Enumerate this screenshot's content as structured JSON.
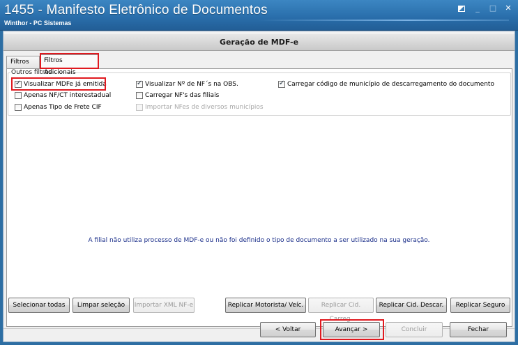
{
  "window": {
    "title": "1455 - Manifesto Eletrônico de Documentos",
    "subtitle": "Winthor - PC Sistemas",
    "controls": {
      "minimize": "_",
      "maximize": "□",
      "close": "✕"
    }
  },
  "header": {
    "title": "Geração de MDF-e"
  },
  "tabs": [
    {
      "label": "Filtros",
      "active": false
    },
    {
      "label": "Filtros Adicionais",
      "active": true
    }
  ],
  "group": {
    "label": "Outros filtros",
    "options": [
      {
        "label": "Visualizar MDFe já emitida",
        "checked": true,
        "enabled": true
      },
      {
        "label": "Apenas NF/CT interestadual",
        "checked": false,
        "enabled": true
      },
      {
        "label": "Apenas Tipo de Frete CIF",
        "checked": false,
        "enabled": true
      },
      {
        "label": "Visualizar Nº de NF´s na OBS.",
        "checked": true,
        "enabled": true
      },
      {
        "label": "Carregar NF's das filiais",
        "checked": false,
        "enabled": true
      },
      {
        "label": "Importar NFes de diversos municípios",
        "checked": false,
        "enabled": false
      },
      {
        "label": "Carregar código de município de descarregamento do documento",
        "checked": true,
        "enabled": true
      }
    ]
  },
  "message": "A filial não utiliza processo de MDF-e ou não foi definido o tipo de documento a ser utilizado na sua geração.",
  "actions": {
    "select_all": "Selecionar todas",
    "clear_selection": "Limpar seleção",
    "import_xml": "Importar XML NF-e",
    "replicate_driver": "Replicar Motorista/ Veíc.",
    "replicate_load_city": "Replicar Cid. Carreg.",
    "replicate_unload_city": "Replicar Cid. Descar.",
    "replicate_insurance": "Replicar Seguro"
  },
  "nav": {
    "back": "< Voltar",
    "next": "Avançar >",
    "finish": "Concluir",
    "close": "Fechar"
  },
  "colors": {
    "titlebar": "#2a6fac",
    "highlight": "#e0191f",
    "message_text": "#1b2f8a"
  }
}
